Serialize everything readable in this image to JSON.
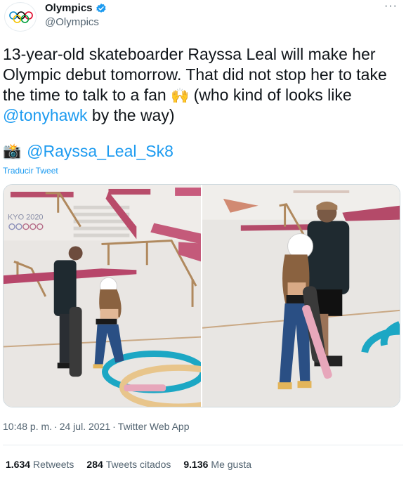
{
  "account": {
    "name": "Olympics",
    "handle": "@Olympics",
    "avatar_icon": "olympic-rings-icon",
    "verified_icon": "verified-badge-icon",
    "more_label": "···"
  },
  "tweet": {
    "text_before": "13-year-old skateboarder Rayssa Leal will make her Olympic debut tomorrow. That did not stop her to take the time to talk to a fan",
    "emoji_hands": "🙌",
    "text_middle": " (who kind of looks like ",
    "mention_tony": "@tonyhawk",
    "text_after": " by the way)",
    "camera_emoji": "📸",
    "mention_rayssa": "@Rayssa_Leal_Sk8",
    "translate_label": "Traducir Tweet"
  },
  "photos": [
    {
      "signage_text": "KYO 2020"
    },
    {}
  ],
  "meta": {
    "time": "10:48 p. m.",
    "date": "24 jul. 2021",
    "separator": "·",
    "app": "Twitter Web App"
  },
  "stats": {
    "retweets_count": "1.634",
    "retweets_label": "Retweets",
    "quotes_count": "284",
    "quotes_label": "Tweets citados",
    "likes_count": "9.136",
    "likes_label": "Me gusta"
  },
  "colors": {
    "link": "#1d9bf0",
    "secondary_text": "#536471",
    "primary_text": "#0f1419"
  }
}
